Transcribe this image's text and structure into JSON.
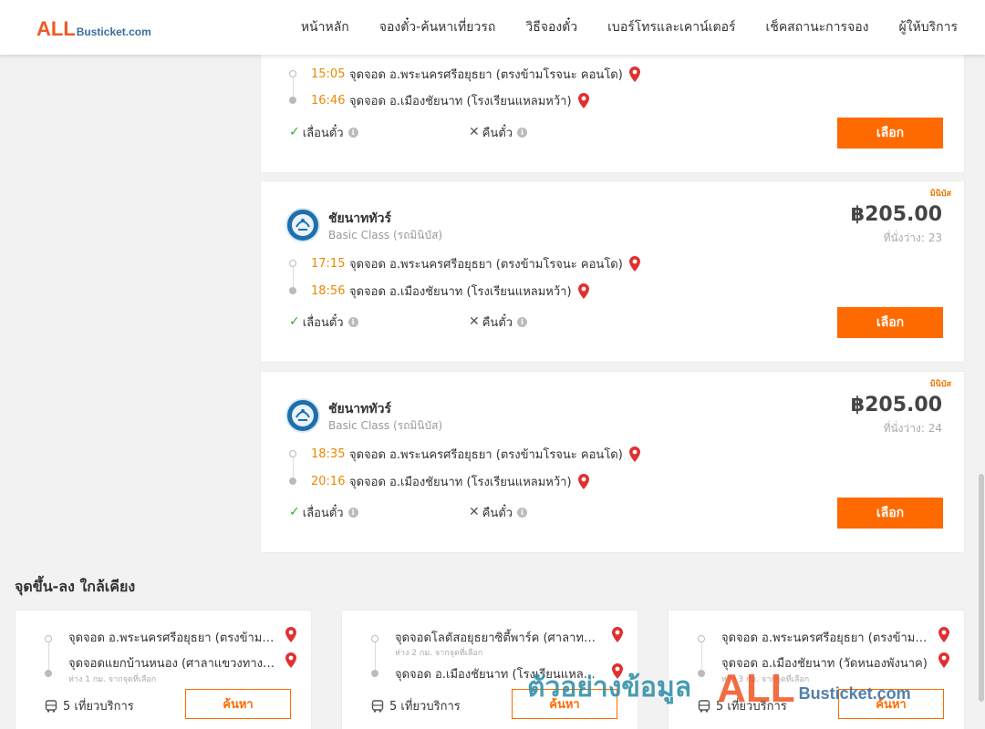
{
  "header": {
    "logo_all": "ALL",
    "logo_site": "Busticket.com",
    "nav": [
      "หน้าหลัก",
      "จองตั๋ว-ค้นหาเที่ยวรถ",
      "วิธีจองตั๋ว",
      "เบอร์โทรและเคาน์เตอร์",
      "เช็คสถานะการจอง",
      "ผู้ให้บริการ"
    ]
  },
  "trips": [
    {
      "partial": true,
      "depart_time": "15:05",
      "depart_stop": "จุดจอด อ.พระนครศรีอยุธยา (ตรงข้ามโรจนะ คอนโด)",
      "arrive_time": "16:46",
      "arrive_stop": "จุดจอด อ.เมืองชัยนาท (โรงเรียนแหลมหว้า)",
      "change_label": "เลื่อนตั๋ว",
      "refund_label": "คืนตั๋ว",
      "select_label": "เลือก"
    },
    {
      "partial": false,
      "tag": "มินิบัส",
      "operator": "ชัยนาททัวร์",
      "class": "Basic Class (รถมินิบัส)",
      "price": "฿205.00",
      "seats": "ที่นั่งว่าง: 23",
      "depart_time": "17:15",
      "depart_stop": "จุดจอด อ.พระนครศรีอยุธยา (ตรงข้ามโรจนะ คอนโด)",
      "arrive_time": "18:56",
      "arrive_stop": "จุดจอด อ.เมืองชัยนาท (โรงเรียนแหลมหว้า)",
      "change_label": "เลื่อนตั๋ว",
      "refund_label": "คืนตั๋ว",
      "select_label": "เลือก"
    },
    {
      "partial": false,
      "tag": "มินิบัส",
      "operator": "ชัยนาททัวร์",
      "class": "Basic Class (รถมินิบัส)",
      "price": "฿205.00",
      "seats": "ที่นั่งว่าง: 24",
      "depart_time": "18:35",
      "depart_stop": "จุดจอด อ.พระนครศรีอยุธยา (ตรงข้ามโรจนะ คอนโด)",
      "arrive_time": "20:16",
      "arrive_stop": "จุดจอด อ.เมืองชัยนาท (โรงเรียนแหลมหว้า)",
      "change_label": "เลื่อนตั๋ว",
      "refund_label": "คืนตั๋ว",
      "select_label": "เลือก"
    }
  ],
  "nearby": {
    "title": "จุดขึ้น-ลง ใกล้เคียง",
    "cards": [
      {
        "from_stop": "จุดจอด อ.พระนครศรีอยุธยา (ตรงข้ามโรจนะ คอนโด)",
        "from_dist": "",
        "to_stop": "จุดจอดแยกบ้านหนอง (ศาลาแขวงทางหลวง)",
        "to_dist": "ห่าง 1 กม. จากจุดที่เลือก",
        "trips": "5 เที่ยวบริการ",
        "search_label": "ค้นหา"
      },
      {
        "from_stop": "จุดจอดโลตัสอยุธยาซิตี้พาร์ค (ศาลาทางเข้า)",
        "from_dist": "ห่าง 2 กม. จากจุดที่เลือก",
        "to_stop": "จุดจอด อ.เมืองชัยนาท (โรงเรียนแหลมหว้า)",
        "to_dist": "",
        "trips": "5 เที่ยวบริการ",
        "search_label": "ค้นหา"
      },
      {
        "from_stop": "จุดจอด อ.พระนครศรีอยุธยา (ตรงข้ามโรจนะ คอนโด)",
        "from_dist": "",
        "to_stop": "จุดจอด อ.เมืองชัยนาท (วัดหนองพังนาค)",
        "to_dist": "ห่าง 3 กม. จากจุดที่เลือก",
        "trips": "5 เที่ยวบริการ",
        "search_label": "ค้นหา"
      }
    ]
  },
  "watermark": {
    "thai": "ตัวอย่างข้อมูล",
    "all": "ALL",
    "site": "Busticket.com"
  },
  "colors": {
    "accent": "#ff6a00",
    "time": "#e98a00",
    "brand_red": "#f05a28",
    "brand_blue": "#3c6e9e",
    "check": "#36a832",
    "pin": "#e03030"
  }
}
